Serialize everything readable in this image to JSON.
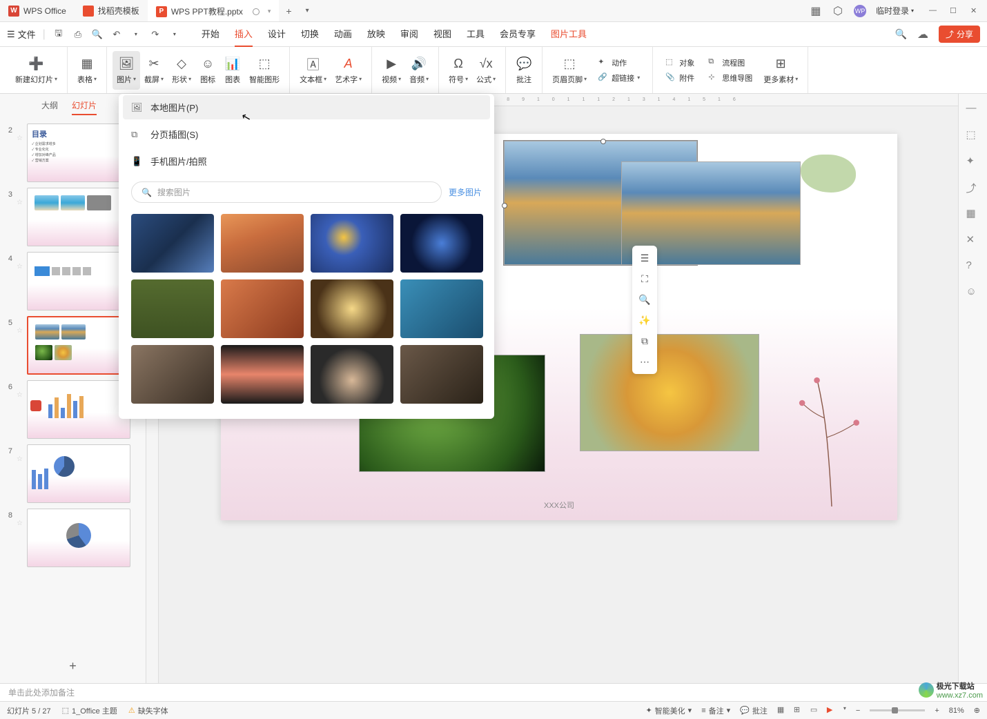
{
  "titlebar": {
    "tabs": [
      {
        "label": "WPS Office",
        "logo": "W"
      },
      {
        "label": "找稻壳模板"
      },
      {
        "label": "WPS PPT教程.pptx",
        "logo": "P",
        "active": true
      }
    ],
    "login": "临时登录"
  },
  "menubar": {
    "file": "文件",
    "tabs": [
      "开始",
      "插入",
      "设计",
      "切换",
      "动画",
      "放映",
      "审阅",
      "视图",
      "工具",
      "会员专享"
    ],
    "active_tab": "插入",
    "context_tab": "图片工具",
    "share": "分享"
  },
  "ribbon": {
    "new_slide": "新建幻灯片",
    "table": "表格",
    "picture": "图片",
    "screenshot": "截屏",
    "shape": "形状",
    "icon": "图标",
    "chart": "图表",
    "smartart": "智能图形",
    "textbox": "文本框",
    "wordart": "艺术字",
    "video": "视频",
    "audio": "音频",
    "symbol": "符号",
    "equation": "公式",
    "comment": "批注",
    "header_footer": "页眉页脚",
    "action": "动作",
    "hyperlink": "超链接",
    "object": "对象",
    "flowchart": "流程图",
    "attachment": "附件",
    "mindmap": "思维导图",
    "more_material": "更多素材"
  },
  "dropdown": {
    "local_picture": "本地图片(P)",
    "page_illustration": "分页插图(S)",
    "phone_picture": "手机图片/拍照",
    "search_placeholder": "搜索图片",
    "more_pictures": "更多图片"
  },
  "slide_panel": {
    "tab_outline": "大纲",
    "tab_slides": "幻灯片",
    "slides": [
      2,
      3,
      4,
      5,
      6,
      7,
      8
    ],
    "selected": 5,
    "slide2_title": "目录",
    "slide2_items": [
      "企划需求增多",
      "专业化化",
      "增加对峰产品",
      "营销方案"
    ]
  },
  "canvas": {
    "company": "XXX公司",
    "notes_placeholder": "单击此处添加备注"
  },
  "statusbar": {
    "slide_info": "幻灯片 5 / 27",
    "theme": "1_Office 主题",
    "missing_font": "缺失字体",
    "smart_beautify": "智能美化",
    "notes": "备注",
    "comments": "批注",
    "zoom": "81%"
  },
  "watermark": {
    "site1": "极光下载站",
    "site2": "www.xz7.com"
  }
}
